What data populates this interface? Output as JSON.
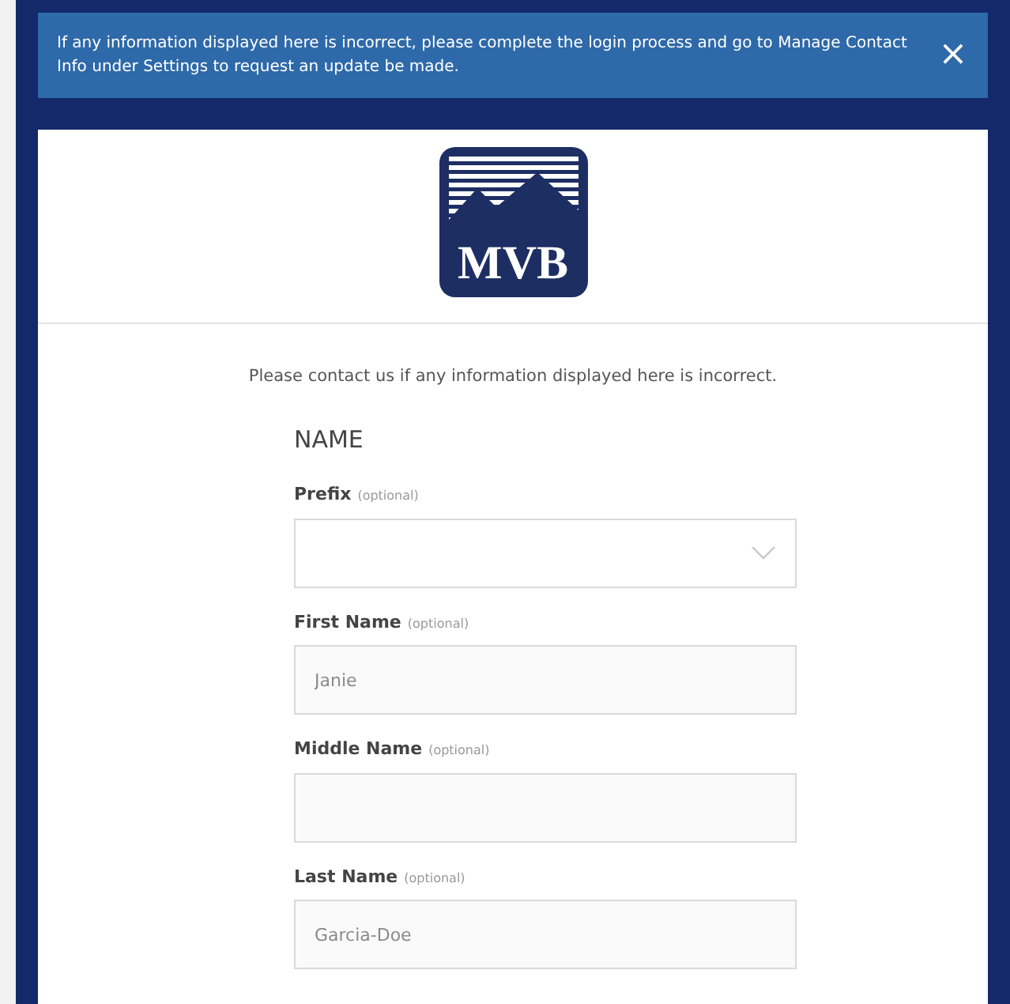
{
  "banner": {
    "message": "If any information displayed here is incorrect, please complete the login process and go to Manage Contact Info under Settings to request an update be made.",
    "close": "×"
  },
  "logo": {
    "text": "MVB"
  },
  "notice": "Please contact us if any information displayed here is incorrect.",
  "section_title": "NAME",
  "fields": [
    {
      "kind": "select",
      "label": "Prefix",
      "hint": "(optional)"
    },
    {
      "kind": "text",
      "label": "First Name",
      "hint": "(optional)",
      "value": "Janie"
    },
    {
      "kind": "text",
      "label": "Middle Name",
      "hint": "(optional)"
    },
    {
      "kind": "text",
      "label": "Last Name",
      "hint": "(optional)",
      "value": "Garcia-Doe"
    }
  ]
}
